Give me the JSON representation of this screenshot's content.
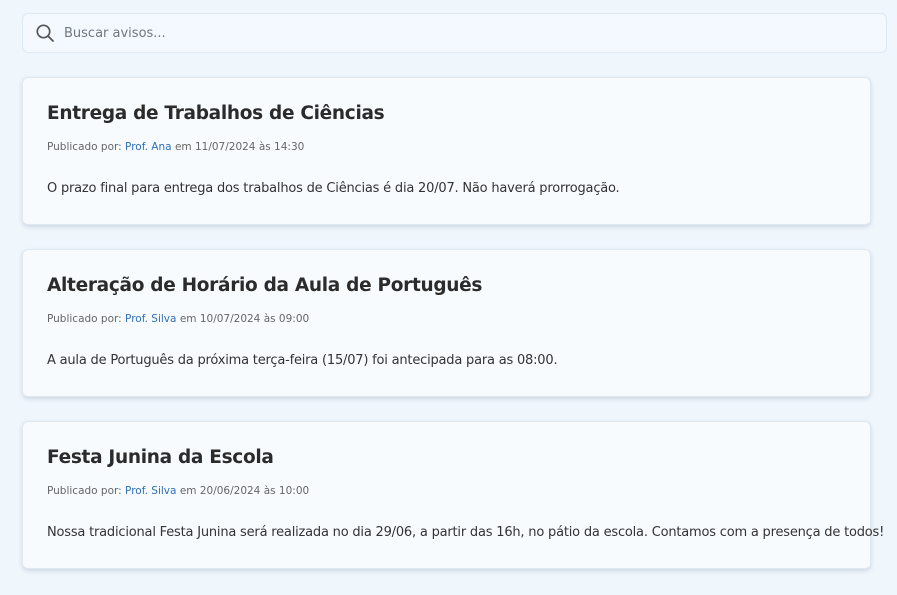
{
  "search": {
    "placeholder": "Buscar avisos..."
  },
  "notices": [
    {
      "title": "Entrega de Trabalhos de Ciências",
      "meta_prefix": "Publicado por:",
      "author": "Prof. Ana",
      "meta_suffix": "em 11/07/2024 às 14:30",
      "body": "O prazo final para entrega dos trabalhos de Ciências é dia 20/07. Não haverá prorrogação."
    },
    {
      "title": "Alteração de Horário da Aula de Português",
      "meta_prefix": "Publicado por:",
      "author": "Prof. Silva",
      "meta_suffix": "em 10/07/2024 às 09:00",
      "body": "A aula de Português da próxima terça-feira (15/07) foi antecipada para as 08:00."
    },
    {
      "title": "Festa Junina da Escola",
      "meta_prefix": "Publicado por:",
      "author": "Prof. Silva",
      "meta_suffix": "em 20/06/2024 às 10:00",
      "body": "Nossa tradicional Festa Junina será realizada no dia 29/06, a partir das 16h, no pátio da escola. Contamos com a presença de todos!"
    }
  ],
  "colors": {
    "background": "#eff6fc",
    "card": "#f8fbfe",
    "author_link": "#2f6fb8"
  },
  "icons": {
    "search": "search-icon"
  }
}
